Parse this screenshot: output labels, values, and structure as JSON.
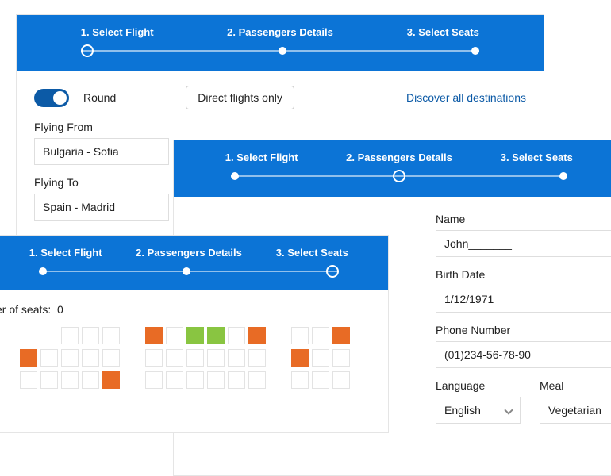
{
  "stepper": {
    "steps": [
      "1. Select Flight",
      "2. Passengers Details",
      "3. Select Seats"
    ]
  },
  "panelA": {
    "round_label": "Round",
    "direct_label": "Direct flights only",
    "discover": "Discover all destinations",
    "from_label": "Flying From",
    "from_value": "Bulgaria - Sofia",
    "to_label": "Flying To",
    "to_value": "Spain - Madrid"
  },
  "panelSeats": {
    "count_label": "er of seats:",
    "count_value": "0"
  },
  "panelForm": {
    "name_label": "Name",
    "name_value": "John_______",
    "birth_label": "Birth Date",
    "birth_value": "1/12/1971",
    "phone_label": "Phone Number",
    "phone_value": "(01)234-56-78-90",
    "lang_label": "Language",
    "lang_value": "English",
    "meal_label": "Meal",
    "meal_value": "Vegetarian"
  }
}
